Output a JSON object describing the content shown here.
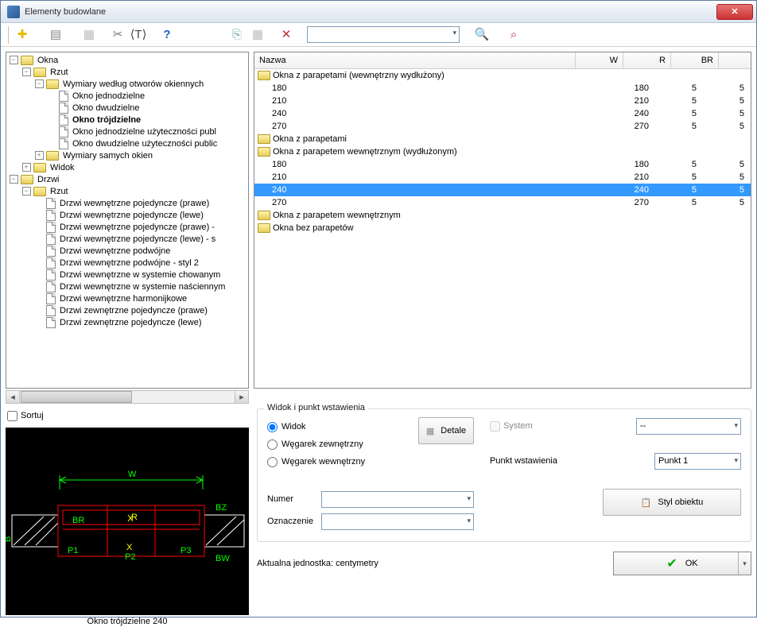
{
  "window": {
    "title": "Elementy budowlane"
  },
  "toolbar": {
    "search": {
      "value": ""
    }
  },
  "tree": {
    "root": {
      "label": "Okna",
      "children": [
        {
          "label": "Rzut",
          "children": [
            {
              "label": "Wymiary według otworów okiennych",
              "children": [
                {
                  "label": "Okno jednodzielne"
                },
                {
                  "label": "Okno dwudzielne"
                },
                {
                  "label": "Okno trójdzielne",
                  "bold": true
                },
                {
                  "label": "Okno jednodzielne użyteczności publ"
                },
                {
                  "label": "Okno dwudzielne użyteczności public"
                }
              ]
            },
            {
              "label": "Wymiary samych okien"
            }
          ]
        },
        {
          "label": "Widok"
        }
      ]
    },
    "root2": {
      "label": "Drzwi",
      "children": [
        {
          "label": "Rzut",
          "children": [
            {
              "label": "Drzwi wewnętrzne pojedyncze (prawe)"
            },
            {
              "label": "Drzwi wewnętrzne pojedyncze (lewe)"
            },
            {
              "label": "Drzwi wewnętrzne pojedyncze (prawe) -"
            },
            {
              "label": "Drzwi wewnętrzne pojedyncze (lewe) - s"
            },
            {
              "label": "Drzwi wewnętrzne podwójne"
            },
            {
              "label": "Drzwi wewnętrzne podwójne - styl 2"
            },
            {
              "label": "Drzwi wewnętrzne w systemie chowanym"
            },
            {
              "label": "Drzwi wewnętrzne w systemie naściennym"
            },
            {
              "label": "Drzwi wewnętrzne harmonijkowe"
            },
            {
              "label": "Drzwi zewnętrzne pojedyncze (prawe)"
            },
            {
              "label": "Drzwi zewnętrzne pojedyncze (lewe)"
            }
          ]
        }
      ]
    }
  },
  "list": {
    "headers": {
      "name": "Nazwa",
      "w": "W",
      "r": "R",
      "br": "BR"
    },
    "groups": [
      {
        "label": "Okna z parapetami (wewnętrzny wydłużony)",
        "rows": [
          {
            "name": "180",
            "w": "180",
            "r": "5",
            "br": "5"
          },
          {
            "name": "210",
            "w": "210",
            "r": "5",
            "br": "5"
          },
          {
            "name": "240",
            "w": "240",
            "r": "5",
            "br": "5"
          },
          {
            "name": "270",
            "w": "270",
            "r": "5",
            "br": "5"
          }
        ]
      },
      {
        "label": "Okna z parapetami",
        "rows": []
      },
      {
        "label": "Okna z parapetem wewnętrznym (wydłużonym)",
        "rows": [
          {
            "name": "180",
            "w": "180",
            "r": "5",
            "br": "5"
          },
          {
            "name": "210",
            "w": "210",
            "r": "5",
            "br": "5"
          },
          {
            "name": "240",
            "w": "240",
            "r": "5",
            "br": "5",
            "selected": true
          },
          {
            "name": "270",
            "w": "270",
            "r": "5",
            "br": "5"
          }
        ]
      },
      {
        "label": "Okna z parapetem wewnętrznym",
        "rows": []
      },
      {
        "label": "Okna bez parapetów",
        "rows": []
      }
    ]
  },
  "sort": {
    "label": "Sortuj"
  },
  "preview": {
    "caption": "Okno trójdzielne 240",
    "labels": {
      "W": "W",
      "B": "B",
      "BR": "BR",
      "R": "R",
      "BZ": "BZ",
      "BW": "BW",
      "P1": "P1",
      "P2": "P2",
      "P3": "P3",
      "X": "X"
    }
  },
  "insertion": {
    "legend": "Widok i punkt wstawienia",
    "radios": {
      "widok": "Widok",
      "zew": "Węgarek zewnętrzny",
      "wew": "Węgarek wewnętrzny"
    },
    "detale": "Detale",
    "system": "System",
    "system_value": "--",
    "punkt_label": "Punkt wstawienia",
    "punkt_value": "Punkt 1",
    "numer": "Numer",
    "oznaczenie": "Oznaczenie",
    "styl": "Styl obiektu"
  },
  "footer": {
    "unit": "Aktualna jednostka: centymetry",
    "ok": "OK"
  }
}
